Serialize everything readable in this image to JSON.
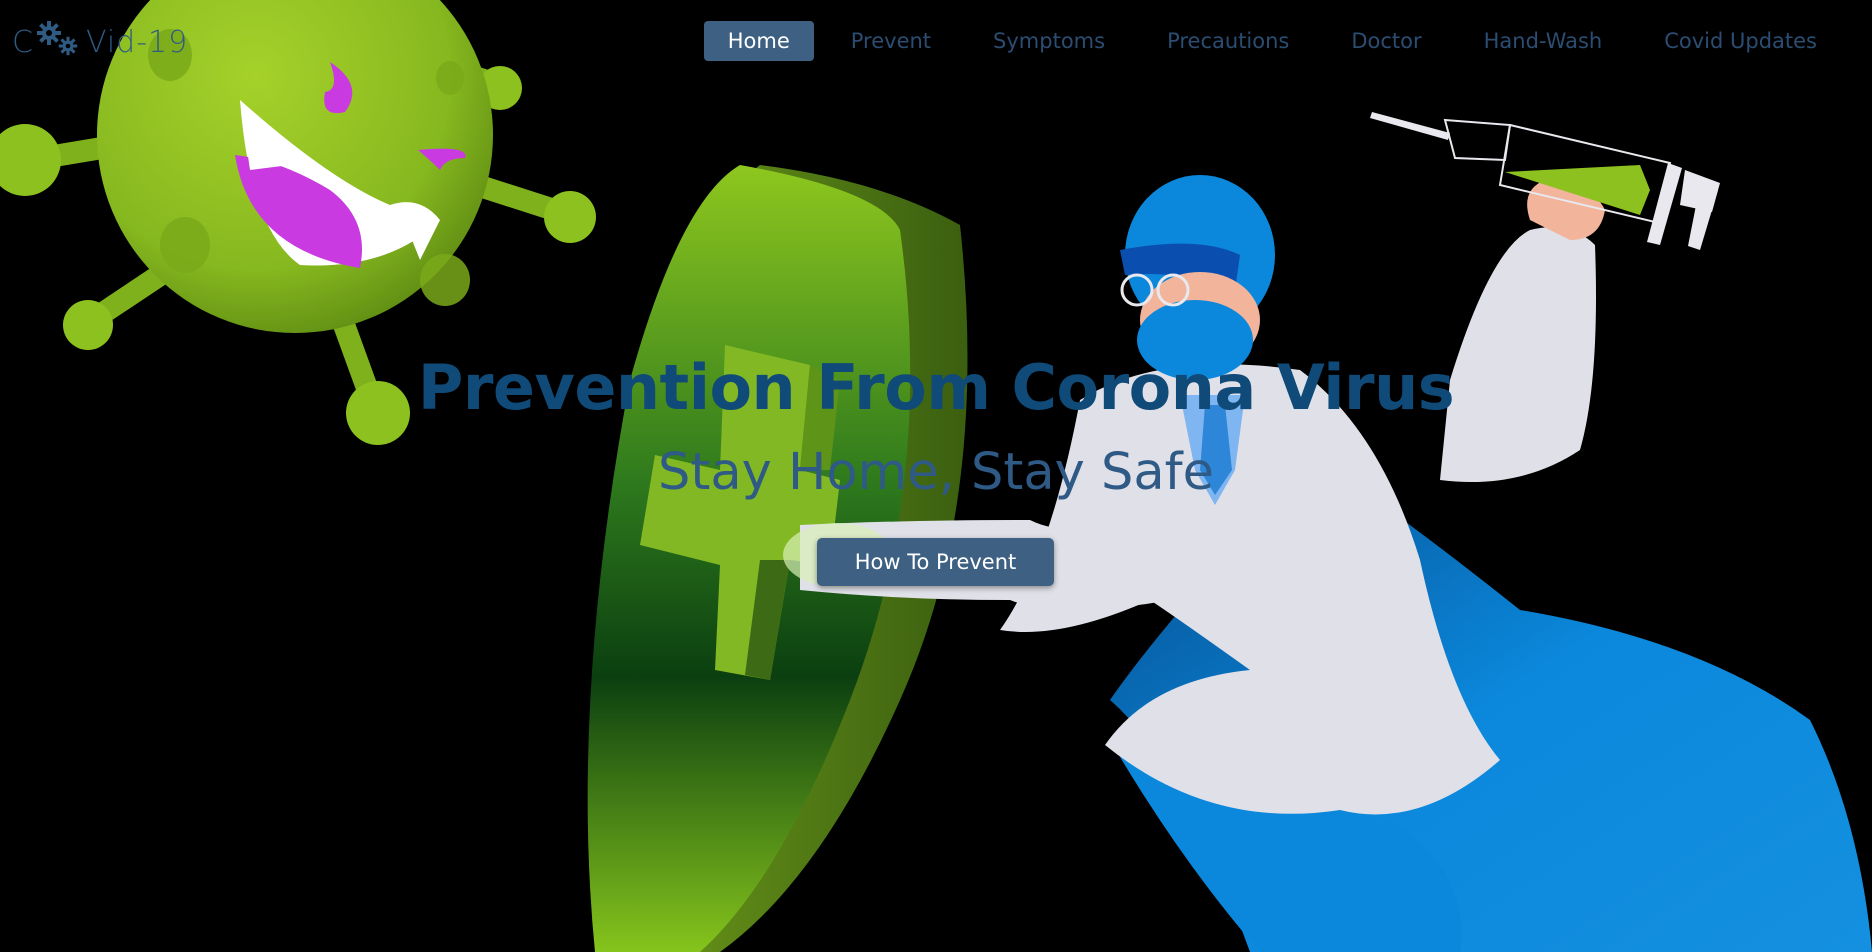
{
  "brand": {
    "prefix": "C",
    "suffix": "Vid-19"
  },
  "nav": {
    "items": [
      {
        "label": "Home",
        "active": true
      },
      {
        "label": "Prevent"
      },
      {
        "label": "Symptoms"
      },
      {
        "label": "Precautions"
      },
      {
        "label": "Doctor"
      },
      {
        "label": "Hand-Wash"
      },
      {
        "label": "Covid Updates"
      }
    ]
  },
  "hero": {
    "title": "Prevention From Corona Virus",
    "subtitle": "Stay Home, Stay Safe",
    "cta_label": "How To Prevent"
  },
  "colors": {
    "background": "#000000",
    "accent": "#3e6183",
    "virus": "#8cc11f",
    "coat_blue": "#0b88dc"
  },
  "illustration": {
    "icons": [
      "virus-icon",
      "shield-icon",
      "cross-icon",
      "doctor-figure",
      "syringe-icon"
    ]
  }
}
